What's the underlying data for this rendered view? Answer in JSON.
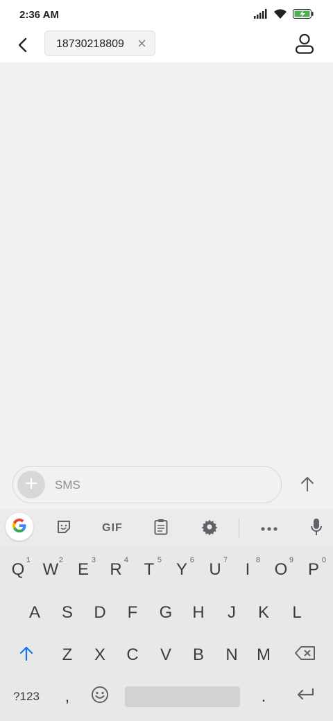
{
  "status_bar": {
    "time": "2:36 AM",
    "icons": [
      "signal-icon",
      "wifi-icon",
      "battery-charging-icon"
    ]
  },
  "header": {
    "recipient_chip": "18730218809",
    "icons": [
      "back-arrow-icon",
      "close-icon",
      "contact-icon"
    ]
  },
  "compose": {
    "placeholder": "SMS",
    "value": ""
  },
  "keyboard_toolbar": {
    "gif_label": "GIF",
    "icons": [
      "google-icon",
      "sticker-icon",
      "clipboard-icon",
      "settings-icon",
      "more-icon",
      "microphone-icon"
    ]
  },
  "keyboard": {
    "row1": [
      {
        "label": "Q",
        "sup": "1"
      },
      {
        "label": "W",
        "sup": "2"
      },
      {
        "label": "E",
        "sup": "3"
      },
      {
        "label": "R",
        "sup": "4"
      },
      {
        "label": "T",
        "sup": "5"
      },
      {
        "label": "Y",
        "sup": "6"
      },
      {
        "label": "U",
        "sup": "7"
      },
      {
        "label": "I",
        "sup": "8"
      },
      {
        "label": "O",
        "sup": "9"
      },
      {
        "label": "P",
        "sup": "0"
      }
    ],
    "row2": [
      "A",
      "S",
      "D",
      "F",
      "G",
      "H",
      "J",
      "K",
      "L"
    ],
    "row3": [
      "Z",
      "X",
      "C",
      "V",
      "B",
      "N",
      "M"
    ],
    "bottom": {
      "symbols": "?123",
      "comma": ",",
      "period": "."
    }
  },
  "colors": {
    "accent": "#1a73e8",
    "background": "#f1f1f1",
    "keyboard": "#e8e8e8"
  }
}
